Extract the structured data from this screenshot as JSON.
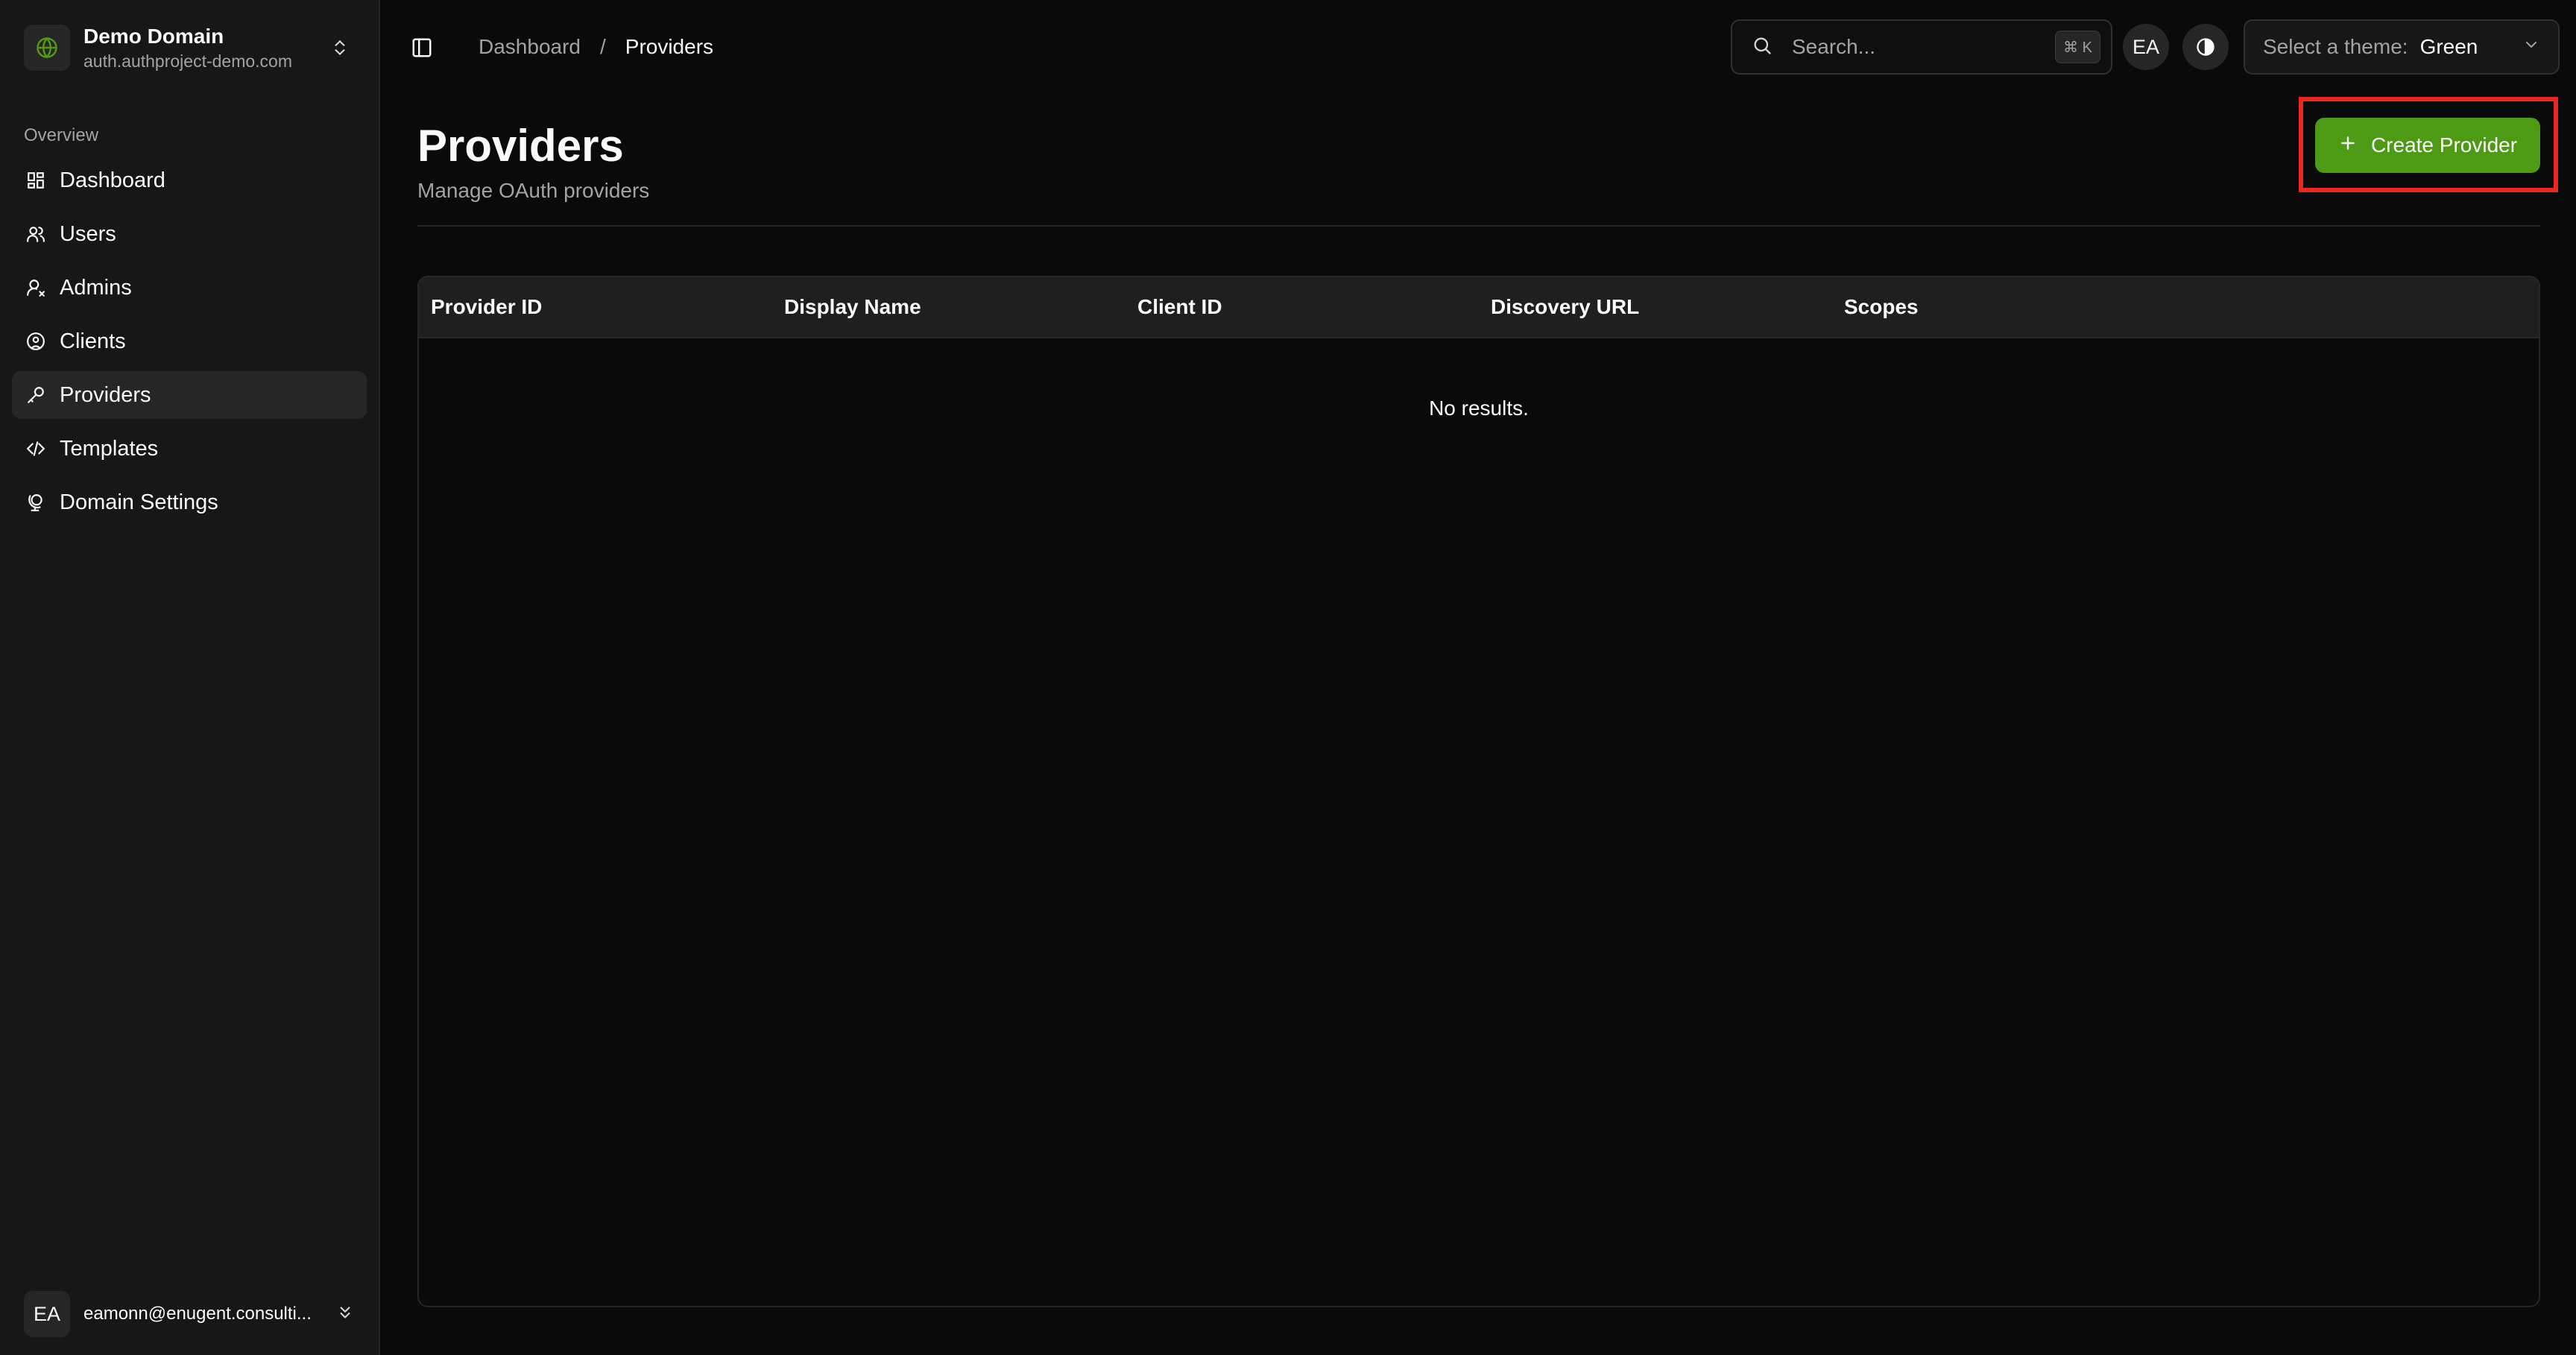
{
  "domain": {
    "name": "Demo Domain",
    "host": "auth.authproject-demo.com"
  },
  "sidebar": {
    "group_label": "Overview",
    "items": [
      {
        "label": "Dashboard",
        "icon": "dashboard-icon"
      },
      {
        "label": "Users",
        "icon": "users-icon"
      },
      {
        "label": "Admins",
        "icon": "admin-icon"
      },
      {
        "label": "Clients",
        "icon": "client-icon"
      },
      {
        "label": "Providers",
        "icon": "key-icon",
        "active": true
      },
      {
        "label": "Templates",
        "icon": "code-icon"
      },
      {
        "label": "Domain Settings",
        "icon": "globe-stand-icon"
      }
    ]
  },
  "user": {
    "initials": "EA",
    "email": "eamonn@enugent.consulti..."
  },
  "breadcrumb": {
    "root": "Dashboard",
    "separator": "/",
    "current": "Providers"
  },
  "search": {
    "placeholder": "Search...",
    "shortcut": "⌘ K"
  },
  "header_avatar": "EA",
  "theme": {
    "label": "Select a theme:",
    "value": "Green"
  },
  "page": {
    "title": "Providers",
    "subtitle": "Manage OAuth providers",
    "create_label": "Create Provider"
  },
  "table": {
    "columns": [
      "Provider ID",
      "Display Name",
      "Client ID",
      "Discovery URL",
      "Scopes"
    ],
    "empty_text": "No results."
  },
  "colors": {
    "accent": "#4d9a14",
    "highlight": "#e8291c",
    "background": "#0a0a0a",
    "sidebar": "#171717"
  }
}
